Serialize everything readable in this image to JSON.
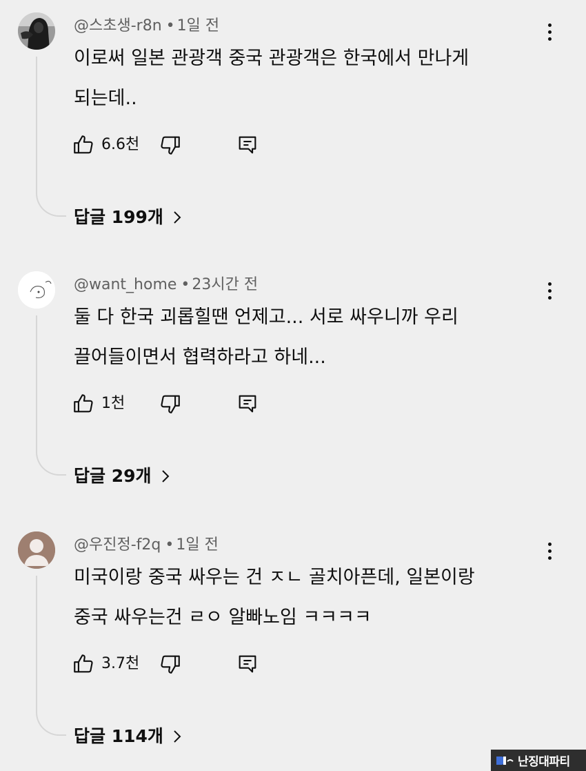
{
  "comments": [
    {
      "handle": "@스초생-r8n",
      "time": "1일 전",
      "text_lines": [
        "이로써 일본 관광객 중국 관광객은 한국에서 만나게",
        "되는데.."
      ],
      "likes": "6.6천",
      "replies_label": "답글 199개",
      "avatar_icon": "dark-photo-avatar"
    },
    {
      "handle": "@want_home",
      "time": "23시간 전",
      "text_lines": [
        "둘 다 한국 괴롭힐땐 언제고... 서로 싸우니까 우리",
        "끌어들이면서 협력하라고 하네..."
      ],
      "likes": "1천",
      "replies_label": "답글 29개",
      "avatar_icon": "sketch-avatar"
    },
    {
      "handle": "@우진정-f2q",
      "time": "1일 전",
      "text_lines": [
        "미국이랑 중국 싸우는 건 ㅈㄴ 골치아픈데, 일본이랑",
        "중국 싸우는건 ㄹㅇ 알빠노임 ㅋㅋㅋㅋ"
      ],
      "likes": "3.7천",
      "replies_label": "답글 114개",
      "avatar_icon": "default-person-avatar"
    }
  ],
  "separator": "•",
  "icons": {
    "like": "thumbs-up-icon",
    "dislike": "thumbs-down-icon",
    "reply": "reply-icon",
    "menu": "more-vert-icon",
    "chevron": "chevron-right-icon"
  },
  "watermark": {
    "text": "난징대파티"
  },
  "colors": {
    "background": "#efefef",
    "text": "#0f0f0f",
    "meta": "#606060"
  }
}
